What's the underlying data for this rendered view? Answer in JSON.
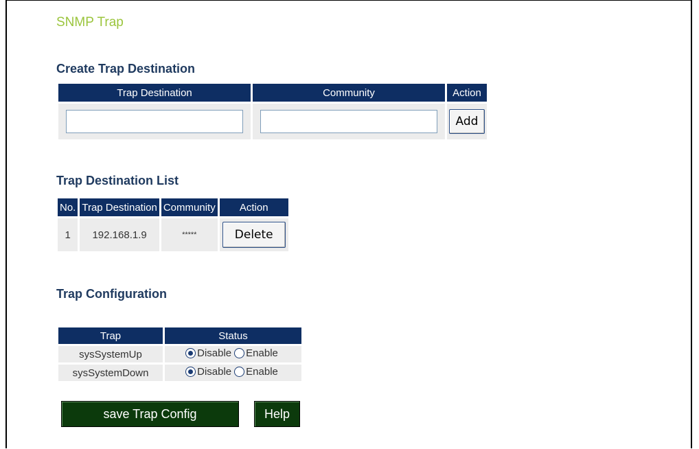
{
  "page_title": "SNMP Trap",
  "create": {
    "title": "Create Trap Destination",
    "headers": [
      "Trap Destination",
      "Community",
      "Action"
    ],
    "destination_value": "",
    "community_value": "",
    "add_label": "Add"
  },
  "list": {
    "title": "Trap Destination List",
    "headers": [
      "No.",
      "Trap Destination",
      "Community",
      "Action"
    ],
    "rows": [
      {
        "no": "1",
        "destination": "192.168.1.9",
        "community": "*****",
        "action": "Delete"
      }
    ]
  },
  "config": {
    "title": "Trap Configuration",
    "headers": [
      "Trap",
      "Status"
    ],
    "rows": [
      {
        "trap": "sysSystemUp",
        "disable_label": "Disable",
        "enable_label": "Enable",
        "selected": "Disable"
      },
      {
        "trap": "sysSystemDown",
        "disable_label": "Disable",
        "enable_label": "Enable",
        "selected": "Disable"
      }
    ],
    "save_label": "save Trap Config",
    "help_label": "Help"
  },
  "colors": {
    "header_bg": "#0e2e63",
    "title_green": "#9bc53d",
    "section_navy": "#1f3a5f",
    "button_green": "#0c3a0c"
  }
}
